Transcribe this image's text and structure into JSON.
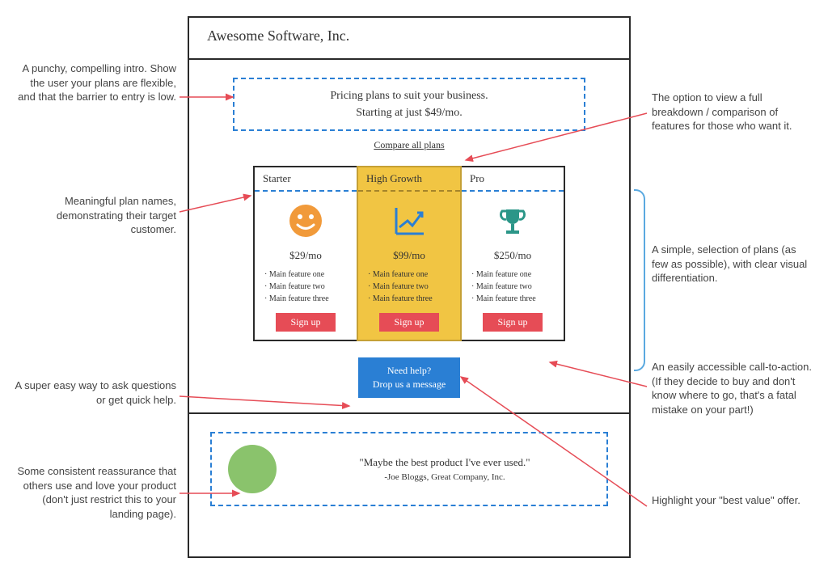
{
  "company": "Awesome Software, Inc.",
  "intro": {
    "headline": "Pricing plans to suit your business.",
    "subline": "Starting at just $49/mo."
  },
  "compare_link": "Compare all plans",
  "plans": [
    {
      "name": "Starter",
      "price": "$29/mo",
      "features": [
        "· Main feature one",
        "· Main feature two",
        "· Main feature  three"
      ],
      "cta": "Sign up"
    },
    {
      "name": "High Growth",
      "price": "$99/mo",
      "features": [
        "· Main feature one",
        "· Main feature two",
        "· Main feature  three"
      ],
      "cta": "Sign up"
    },
    {
      "name": "Pro",
      "price": "$250/mo",
      "features": [
        "· Main feature one",
        "· Main feature two",
        "· Main feature  three"
      ],
      "cta": "Sign up"
    }
  ],
  "help": {
    "title": "Need help?",
    "sub": "Drop us a message"
  },
  "testimonial": {
    "quote": "\"Maybe the best product I've ever used.\"",
    "attrib": "-Joe Bloggs, Great Company, Inc."
  },
  "annotations": {
    "intro": "A punchy, compelling intro. Show the user your plans are flexible, and that the barrier to entry is low.",
    "plan_names": "Meaningful plan names, demonstrating their target customer.",
    "help": "A super easy way to ask questions or get quick help.",
    "testimonial": "Some consistent reassurance that others use and love your product (don't just restrict this to your landing page).",
    "compare": "The option to view a full breakdown / comparison of features for those who want it.",
    "plans": "A simple, selection of plans (as few as possible), with clear visual differentiation.",
    "cta": "An easily accessible call-to-action. (If they decide to buy and don't know where to go, that's a fatal mistake on your part!)",
    "highlight": "Highlight your \"best value\" offer."
  }
}
